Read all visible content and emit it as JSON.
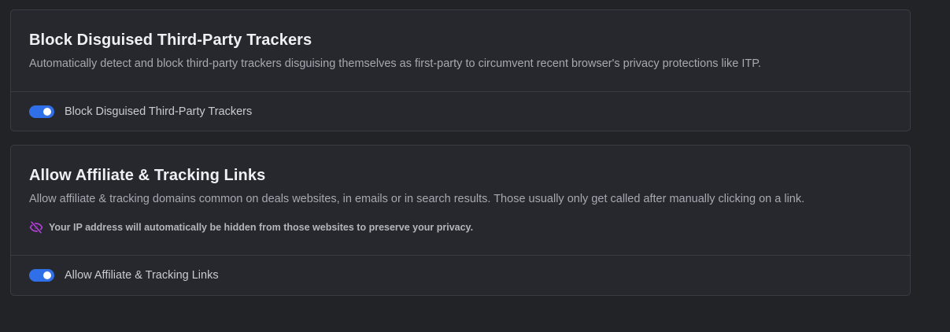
{
  "colors": {
    "background": "#212327",
    "card_background": "#26282d",
    "border": "#3a3d44",
    "toggle_on": "#2f6fe8",
    "privacy_icon": "#b43fd8"
  },
  "sections": [
    {
      "title": "Block Disguised Third-Party Trackers",
      "description": "Automatically detect and block third-party trackers disguising themselves as first-party to circumvent recent browser's privacy protections like ITP.",
      "toggle": {
        "label": "Block Disguised Third-Party Trackers",
        "enabled": true
      }
    },
    {
      "title": "Allow Affiliate & Tracking Links",
      "description": "Allow affiliate & tracking domains common on deals websites, in emails or in search results. Those usually only get called after manually clicking on a link.",
      "note": {
        "icon": "eye-slash-icon",
        "text": "Your IP address will automatically be hidden from those websites to preserve your privacy."
      },
      "toggle": {
        "label": "Allow Affiliate & Tracking Links",
        "enabled": true
      }
    }
  ]
}
